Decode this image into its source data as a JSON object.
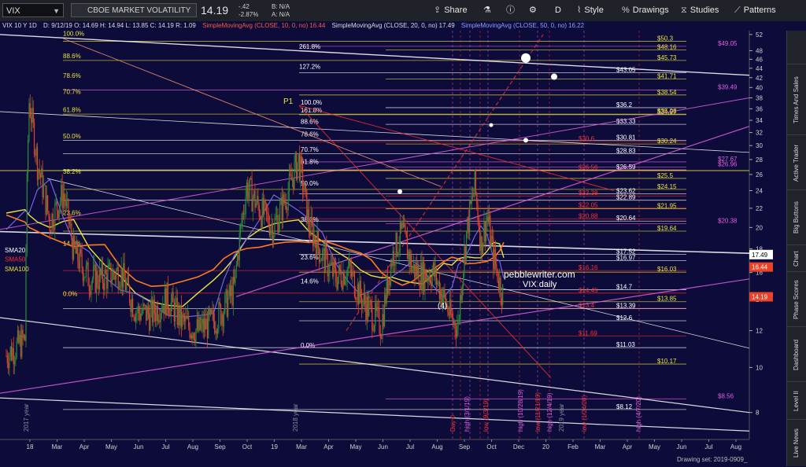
{
  "toolbar": {
    "symbol": "VIX",
    "title": "CBOE MARKET VOLATILITY INDEX",
    "last": "14.19",
    "chg": "-.42",
    "chg_pct": "-2.87%",
    "bid": "B: N/A",
    "ask": "A: N/A",
    "share": "Share",
    "period": "D",
    "style": "Style",
    "drawings": "Drawings",
    "studies": "Studies",
    "patterns": "Patterns"
  },
  "legend": {
    "header": "VIX 10 Y 1D",
    "ohlc": "D: 9/12/19   O: 14.69   H: 14.94   L: 13.85   C: 14.19   R: 1.09",
    "sma10": "SimpleMovingAvg (CLOSE, 10, 0, no)",
    "sma10_val": "16.44",
    "sma20": "SimpleMovingAvg (CLOSE, 20, 0, no)",
    "sma20_val": "17.49",
    "sma50": "SimpleMovingAvg (CLOSE, 50, 0, no)",
    "sma50_val": "16.22"
  },
  "sidebar_tabs": [
    "Live News",
    "Level II",
    "Dashboard",
    "Phase Scores",
    "Chart",
    "Big Buttons",
    "Active Trader",
    "Times And Sales"
  ],
  "footer": "Drawing set: 2019-0909_",
  "watermark": "pebblewriter.com",
  "watermark2": "VIX daily",
  "colors": {
    "background": "#0d0b3a",
    "price_up": "#2e8b3a",
    "price_down": "#e8432a",
    "sma20": "#7a6df0",
    "sma50": "#e9e43c",
    "fib_magenta": "#e060e0",
    "fib_yellow": "#e9e43c",
    "fib_red": "#ff3030",
    "fib_white": "#ffffff"
  },
  "chart_data": {
    "type": "candlestick",
    "title": "VIX 10 Y 1D",
    "x_ticks": [
      "18",
      "Mar",
      "Apr",
      "May",
      "Jun",
      "Jul",
      "Aug",
      "Sep",
      "Oct",
      "19",
      "Mar",
      "Apr",
      "May",
      "Jun",
      "Jul",
      "Aug",
      "Sep",
      "Oct",
      "Dec",
      "20",
      "Feb",
      "Mar",
      "Apr",
      "May",
      "Jun",
      "Jul",
      "Aug"
    ],
    "y_ticks": [
      8,
      10,
      12,
      14,
      16,
      18,
      20,
      22,
      24,
      26,
      28,
      30,
      32,
      34,
      36,
      38,
      40,
      42,
      44,
      46,
      48,
      52
    ],
    "y_scale": "log",
    "ylim": [
      7,
      53
    ],
    "last_close": 14.19,
    "right_markers": [
      {
        "label": "17.49",
        "value": 17.49
      },
      {
        "label": "16.44",
        "value": 16.44
      },
      {
        "label": "14.19",
        "value": 14.19
      }
    ],
    "ma_labels": [
      "SMA20",
      "SMA50",
      "SMA100"
    ],
    "hline_labels": [
      {
        "text": "$50.3",
        "value": 50.3
      },
      {
        "text": "$49.05",
        "value": 49.05
      },
      {
        "text": "$48.16",
        "value": 48.16
      },
      {
        "text": "$45.73",
        "value": 45.73
      },
      {
        "text": "$43.05",
        "value": 43.05
      },
      {
        "text": "$41.71",
        "value": 41.71
      },
      {
        "text": "$39.49",
        "value": 39.49
      },
      {
        "text": "$38.54",
        "value": 38.54
      },
      {
        "text": "$36.2",
        "value": 36.2
      },
      {
        "text": "$35.06",
        "value": 35.06
      },
      {
        "text": "$34.97",
        "value": 34.97
      },
      {
        "text": "$33.33",
        "value": 33.33
      },
      {
        "text": "$30.81",
        "value": 30.81
      },
      {
        "text": "$30.6",
        "value": 30.6
      },
      {
        "text": "$30.24",
        "value": 30.24
      },
      {
        "text": "$28.83",
        "value": 28.83
      },
      {
        "text": "$27.67",
        "value": 27.67
      },
      {
        "text": "$26.96",
        "value": 26.96
      },
      {
        "text": "$26.59",
        "value": 26.59
      },
      {
        "text": "$26.56",
        "value": 26.56
      },
      {
        "text": "$25.5",
        "value": 25.5
      },
      {
        "text": "$24.15",
        "value": 24.15
      },
      {
        "text": "$23.62",
        "value": 23.62
      },
      {
        "text": "$23.38",
        "value": 23.38
      },
      {
        "text": "$22.89",
        "value": 22.89
      },
      {
        "text": "$22.05",
        "value": 22.05
      },
      {
        "text": "$21.95",
        "value": 21.95
      },
      {
        "text": "$20.88",
        "value": 20.88
      },
      {
        "text": "$20.64",
        "value": 20.64
      },
      {
        "text": "$20.38",
        "value": 20.38
      },
      {
        "text": "$19.64",
        "value": 19.64
      },
      {
        "text": "$17.52",
        "value": 17.52
      },
      {
        "text": "$16.97",
        "value": 16.97
      },
      {
        "text": "$16.16",
        "value": 16.16
      },
      {
        "text": "$16.03",
        "value": 16.03
      },
      {
        "text": "$14.7",
        "value": 14.7
      },
      {
        "text": "$14.45",
        "value": 14.45
      },
      {
        "text": "$13.85",
        "value": 13.85
      },
      {
        "text": "$13.4",
        "value": 13.4
      },
      {
        "text": "$13.39",
        "value": 13.39
      },
      {
        "text": "$12.6",
        "value": 12.6
      },
      {
        "text": "$11.69",
        "value": 11.69
      },
      {
        "text": "$11.03",
        "value": 11.03
      },
      {
        "text": "$10.17",
        "value": 10.17
      },
      {
        "text": "$8.56",
        "value": 8.56
      },
      {
        "text": "$8.12",
        "value": 8.12
      }
    ],
    "fib_labels": [
      {
        "text": "100.0%",
        "value": 51.5
      },
      {
        "text": "88.6%",
        "value": 46.1
      },
      {
        "text": "78.6%",
        "value": 41.8
      },
      {
        "text": "70.7%",
        "value": 38.6
      },
      {
        "text": "61.8%",
        "value": 35.3
      },
      {
        "text": "50.0%",
        "value": 31.0
      },
      {
        "text": "38.2%",
        "value": 26.0
      },
      {
        "text": "23.6%",
        "value": 21.2
      },
      {
        "text": "14.6%",
        "value": 18.2
      },
      {
        "text": "0.0%",
        "value": 14.2
      },
      {
        "text": "127.2%",
        "value": 43.7
      },
      {
        "text": "261.8%",
        "value": 48.3
      },
      {
        "text": "161.8%",
        "value": 35.2
      },
      {
        "text": "100.0%",
        "value": 36.6
      },
      {
        "text": "88.6%",
        "value": 33.3
      },
      {
        "text": "78.6%",
        "value": 31.3
      },
      {
        "text": "70.7%",
        "value": 29.0
      },
      {
        "text": "61.8%",
        "value": 27.3
      },
      {
        "text": "50.0%",
        "value": 24.5
      },
      {
        "text": "38.2%",
        "value": 20.5
      },
      {
        "text": "23.6%",
        "value": 17.0
      },
      {
        "text": "14.6%",
        "value": 15.1
      },
      {
        "text": "0.0%",
        "value": 11.0
      }
    ],
    "cycle_labels": [
      "high (3/1/19)",
      "low (9/3/19)",
      "high (10/28/19)",
      "low (11/21/19)",
      "high (12/4/19)",
      "low (1/24/20)",
      "high (4/7/20)",
      "Day 0"
    ],
    "annotations": [
      "(4)",
      "P1",
      "2017 year",
      "2018 year",
      "2019 year"
    ],
    "candle_pattern": [
      [
        0,
        10.6
      ],
      [
        18,
        11.5
      ],
      [
        22,
        37.3
      ],
      [
        30,
        27.5
      ],
      [
        42,
        20.5
      ],
      [
        55,
        23.7
      ],
      [
        65,
        17.8
      ],
      [
        80,
        15.5
      ],
      [
        95,
        15.6
      ],
      [
        110,
        16.1
      ],
      [
        125,
        13.2
      ],
      [
        140,
        13.0
      ],
      [
        155,
        14.1
      ],
      [
        170,
        12.5
      ],
      [
        185,
        12.0
      ],
      [
        200,
        12.6
      ],
      [
        210,
        13.4
      ],
      [
        220,
        14.8
      ],
      [
        232,
        24.5
      ],
      [
        245,
        21.8
      ],
      [
        258,
        20.0
      ],
      [
        270,
        23.2
      ],
      [
        282,
        28.0
      ],
      [
        292,
        20.2
      ],
      [
        305,
        17.3
      ],
      [
        318,
        15.6
      ],
      [
        330,
        16.3
      ],
      [
        342,
        14.2
      ],
      [
        352,
        13.1
      ],
      [
        362,
        12.3
      ],
      [
        372,
        17.2
      ],
      [
        382,
        19.5
      ],
      [
        392,
        16.3
      ],
      [
        402,
        15.8
      ],
      [
        412,
        16.0
      ],
      [
        422,
        14.1
      ],
      [
        430,
        12.6
      ],
      [
        436,
        12.3
      ],
      [
        444,
        19.4
      ],
      [
        452,
        24.6
      ],
      [
        458,
        18.3
      ],
      [
        464,
        21.1
      ],
      [
        470,
        17.3
      ],
      [
        476,
        15.2
      ],
      [
        480,
        14.19
      ]
    ]
  }
}
